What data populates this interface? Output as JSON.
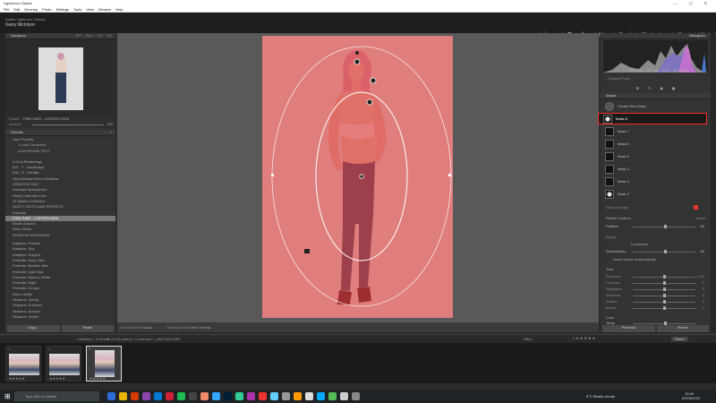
{
  "window": {
    "title": "Lightroom Classic"
  },
  "menu": [
    "File",
    "Edit",
    "Develop",
    "Photo",
    "Settings",
    "Tools",
    "View",
    "Window",
    "Help"
  ],
  "identity": {
    "line1": "Adobe Lightroom Classic",
    "line2": "Garry McIntyre"
  },
  "modules": [
    "Library",
    "Develop",
    "Map",
    "Book",
    "Slideshow",
    "Print",
    "Web"
  ],
  "active_module": "Develop",
  "navigator": {
    "title": "Navigator",
    "zoom": [
      "FIT",
      "FILL",
      "1:1",
      "3:1"
    ]
  },
  "preset_info": {
    "preset_label": "Preset :",
    "preset_value": "PINK HAIR - LIGHTEN SKIN",
    "amount_label": "Amount",
    "amount_value": "100"
  },
  "presets": {
    "title": "Presets",
    "user_presets": "User Presets",
    "user_sub": [
      "1 Look Correction",
      "LIGHTROOM TEST"
    ],
    "items": [
      "4 Cool Renderings",
      "#01 - T - Landscape",
      "#06 - S - Portrait",
      "45m Mohave Retro Workflow",
      "CREATIVE EDIT",
      "Dramatic Atmosphere",
      "Hitcity Calendar Exec",
      "JP Master Collection",
      "NOSTY SCOTLAND PRESETS",
      "Portraits"
    ],
    "selected": "PINK HAIR - LIGHTEN SKIN",
    "items2": [
      "Rustic Autumn",
      "Retro Sleep",
      "WORK IN PROGRESS"
    ],
    "adaptive": [
      "Adaptive: Portrait",
      "Adaptive: Sky",
      "Adaptive: Subject",
      "Portraits: Deep Skin",
      "Portraits: Medium Skin",
      "Portraits: Light Skin",
      "Portraits: Black & White",
      "Portraits: Edge",
      "Portraits: Groups",
      "Retro: Matte",
      "Seasons: Spring",
      "Seasons: Summer",
      "Seasons: Autumn",
      "Seasons: Winter"
    ]
  },
  "left_buttons": {
    "copy": "Copy...",
    "paste": "Paste"
  },
  "toolbar": {
    "show_edit_pins": "Show Edit Pins :",
    "auto": "Auto",
    "overlay_label": "Overlay Mode :",
    "overlay_value": "Color Overlay"
  },
  "histogram": {
    "title": "Histogram",
    "iso": "ISO 400",
    "focal": "140 mm",
    "aperture": "f/3.2",
    "shutter": "1/125 sec",
    "original": "Original Photo"
  },
  "masks": {
    "title": "Masks",
    "create": "Create New Mask",
    "rows": [
      "Mask 8",
      "Mask 7",
      "Mask 6",
      "Mask 5",
      "Mask 4",
      "Mask 3",
      "Mask 2"
    ],
    "selected_index": 0,
    "show_overlay": "Show Overlay"
  },
  "radial": {
    "title": "Radial Gradient",
    "feather_label": "Feather",
    "feather_value": "50",
    "invert_label": "Invert"
  },
  "range": {
    "title": "Range :",
    "luminance": "Luminance",
    "smooth_label": "Smoothness",
    "smooth_value": "50",
    "invert_label": "Invert Values Automatically"
  },
  "tone": {
    "title": "Tone",
    "rows": [
      {
        "label": "Exposure",
        "value": "0.00",
        "pos": 0.5
      },
      {
        "label": "Contrast",
        "value": "0",
        "pos": 0.5
      },
      {
        "label": "Highlights",
        "value": "0",
        "pos": 0.5
      },
      {
        "label": "Shadows",
        "value": "0",
        "pos": 0.5
      },
      {
        "label": "Whites",
        "value": "0",
        "pos": 0.5
      },
      {
        "label": "Blacks",
        "value": "0",
        "pos": 0.5
      }
    ]
  },
  "color": {
    "title": "Color",
    "temp_label": "Temp",
    "tint_label": "Tint"
  },
  "right_buttons": {
    "previous": "Previous",
    "reset": "Reset"
  },
  "filmstrip_bar": {
    "text": "Collection : Portraits",
    "count": "3 of 145 photos / 1 selected / _DMC4254.NEF",
    "filter_label": "Filter :",
    "filter_value": "Rated"
  },
  "filmstrip_items": [
    {
      "num": "1"
    },
    {
      "num": "2"
    },
    {
      "num": "3"
    }
  ],
  "taskbar": {
    "search_placeholder": "Type here to search",
    "weather": "5°C  Mostly cloudy",
    "time": "10:45",
    "date": "02/03/2023"
  },
  "colors": {
    "mask_overlay": "#dc3c3c",
    "highlight_border": "#ff2a2a",
    "accent": "#ffffff"
  }
}
